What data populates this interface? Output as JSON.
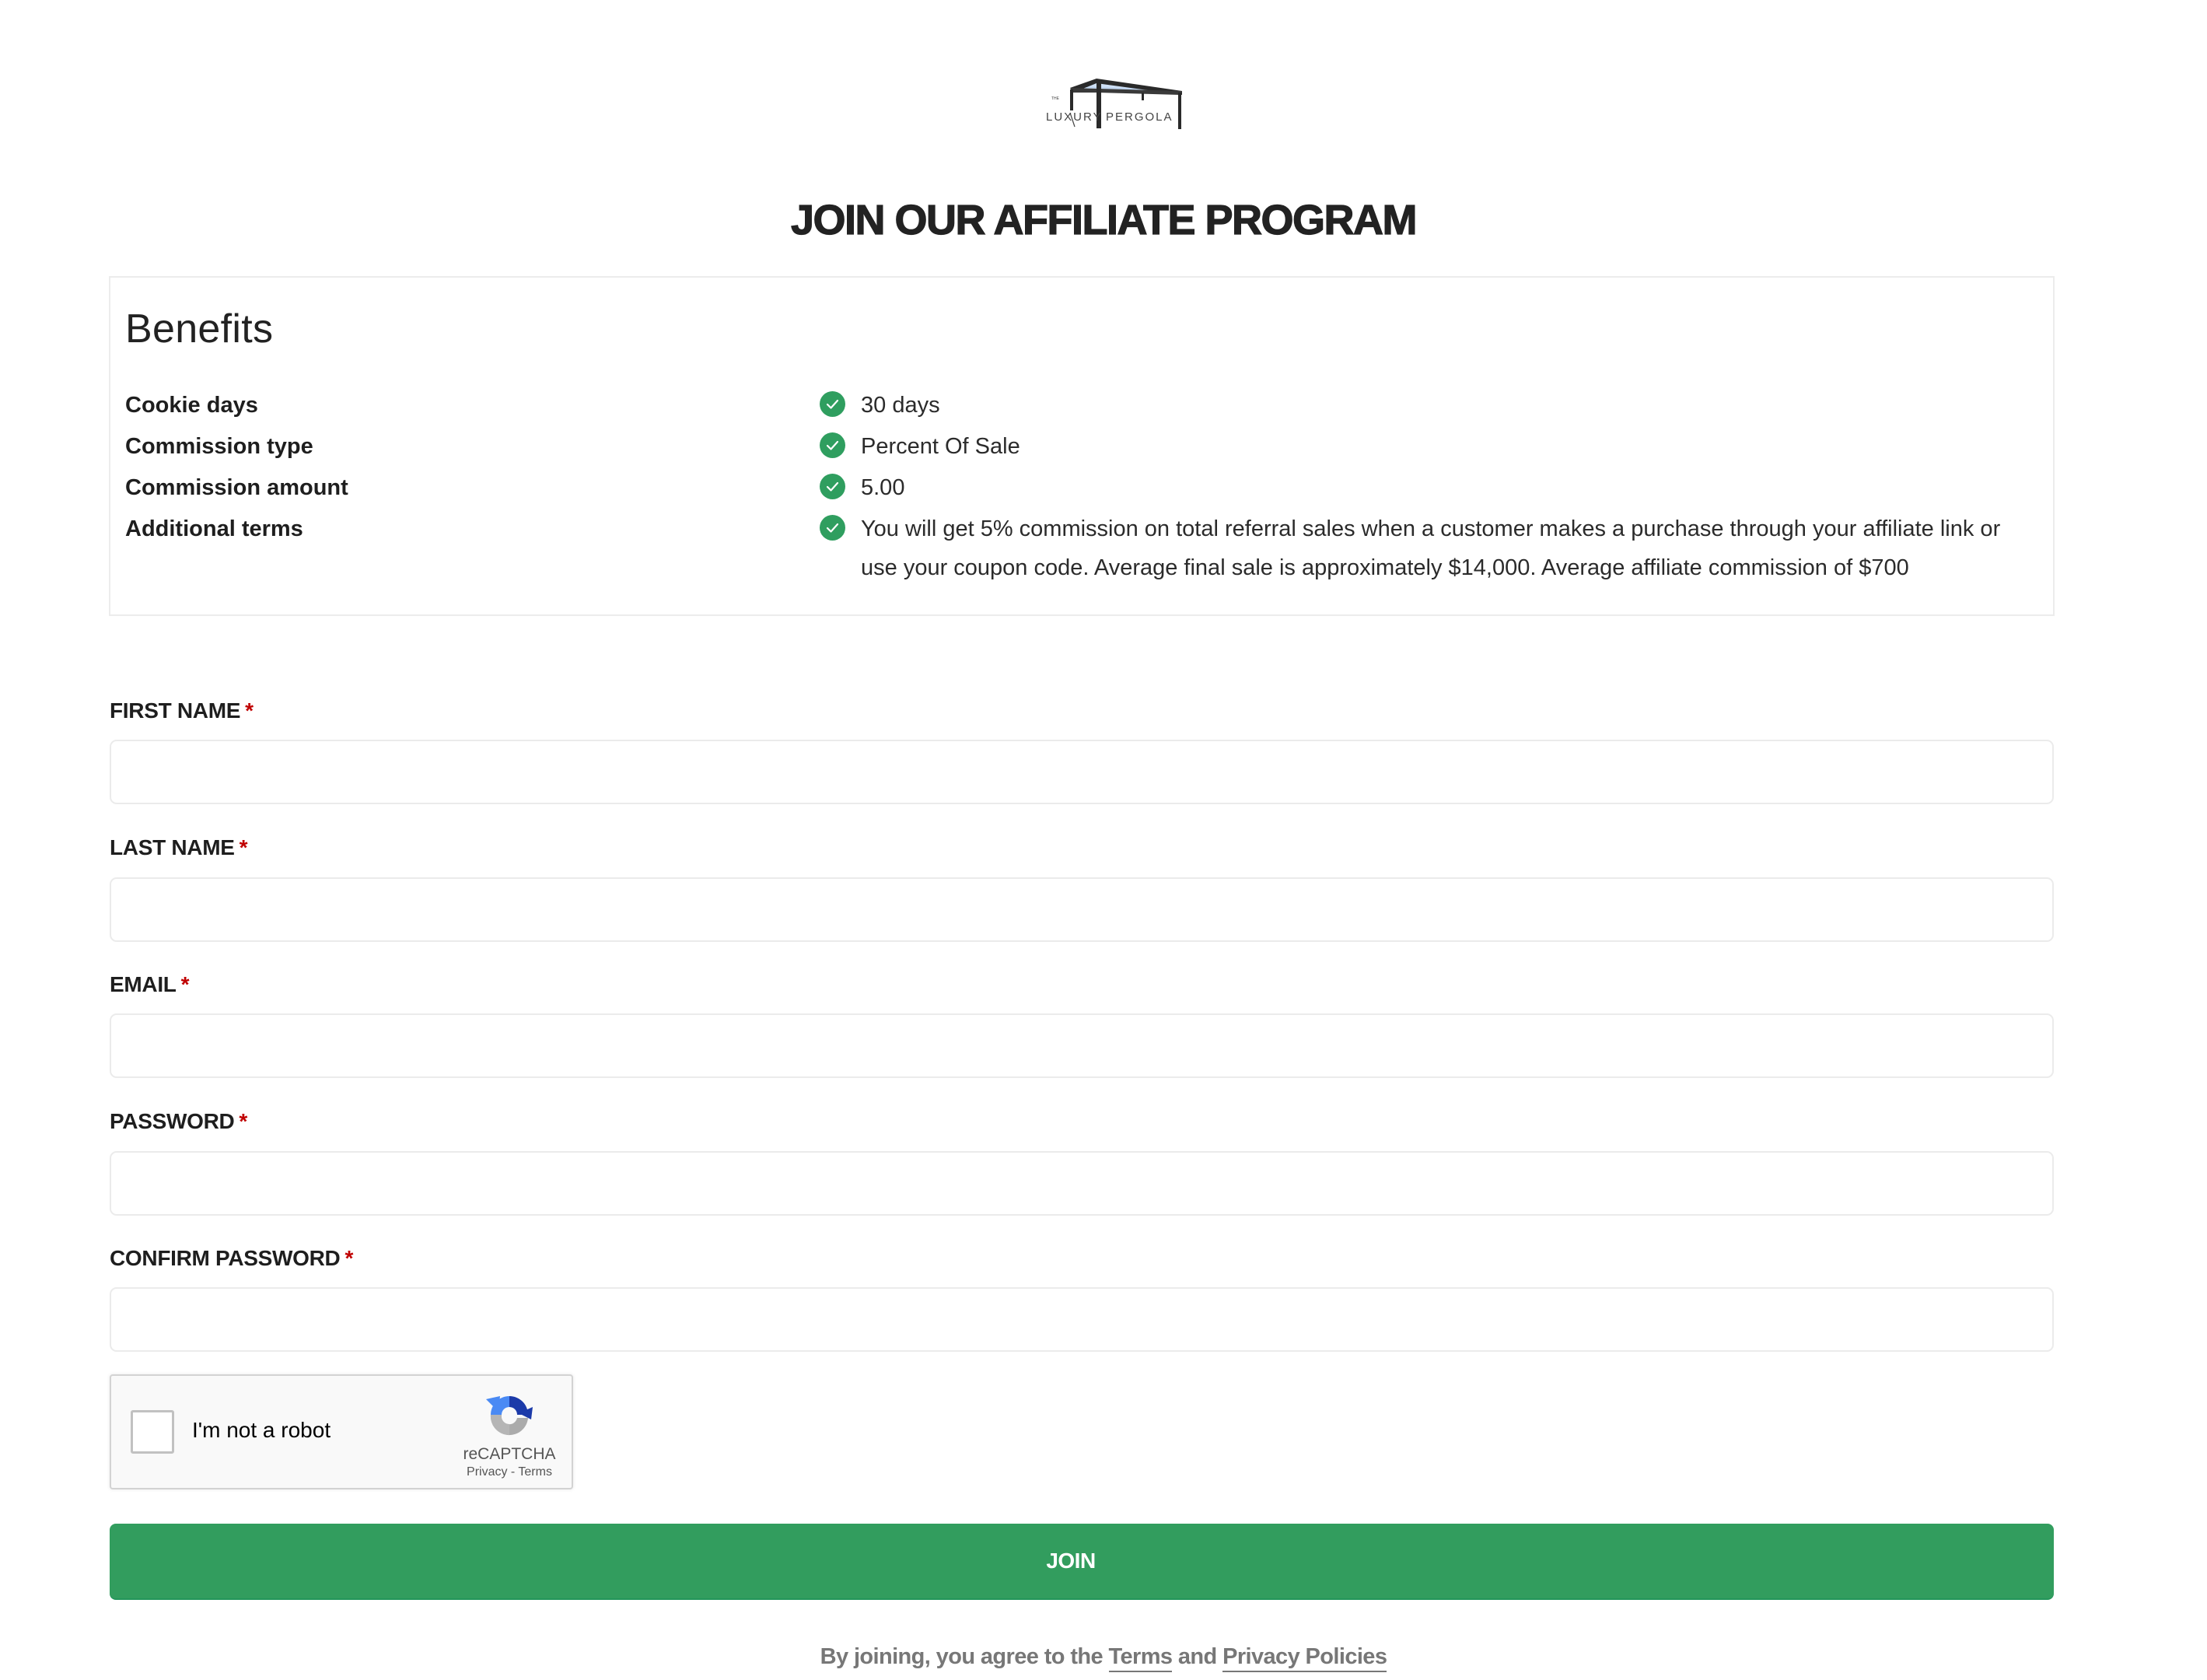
{
  "brand": {
    "logo_icon": "pergola-logo-icon",
    "logo_small_text": "THE",
    "logo_text_left": "LUXURY",
    "logo_text_right": "PERGOLA"
  },
  "page": {
    "title": "JOIN OUR AFFILIATE PROGRAM"
  },
  "benefits": {
    "title": "Benefits",
    "check_icon": "check-circle-icon",
    "accent_color": "#2f9e5f",
    "items": [
      {
        "label": "Cookie days",
        "value": "30 days"
      },
      {
        "label": "Commission type",
        "value": "Percent Of Sale"
      },
      {
        "label": "Commission amount",
        "value": "5.00"
      },
      {
        "label": "Additional terms",
        "value": "You will get 5% commission on total referral sales when a customer makes a purchase through your affiliate link or use your coupon code. Average final sale is approximately $14,000. Average affiliate commission of $700"
      }
    ]
  },
  "form": {
    "required_marker": "*",
    "required_color": "#c00000",
    "fields": [
      {
        "label": "FIRST NAME",
        "value": "",
        "placeholder": ""
      },
      {
        "label": "LAST NAME",
        "value": "",
        "placeholder": ""
      },
      {
        "label": "EMAIL",
        "value": "",
        "placeholder": ""
      },
      {
        "label": "PASSWORD",
        "value": "",
        "placeholder": ""
      },
      {
        "label": "CONFIRM PASSWORD",
        "value": "",
        "placeholder": ""
      }
    ],
    "recaptcha": {
      "label": "I'm not a robot",
      "checked": false,
      "brand": "reCAPTCHA",
      "privacy_link": "Privacy",
      "separator": " - ",
      "terms_link": "Terms"
    },
    "submit_label": "JOIN",
    "submit_color": "#329d5e"
  },
  "footer": {
    "prefix": "By joining, you agree to the ",
    "terms_link": "Terms",
    "conjunction": " and ",
    "privacy_link": "Privacy Policies"
  }
}
